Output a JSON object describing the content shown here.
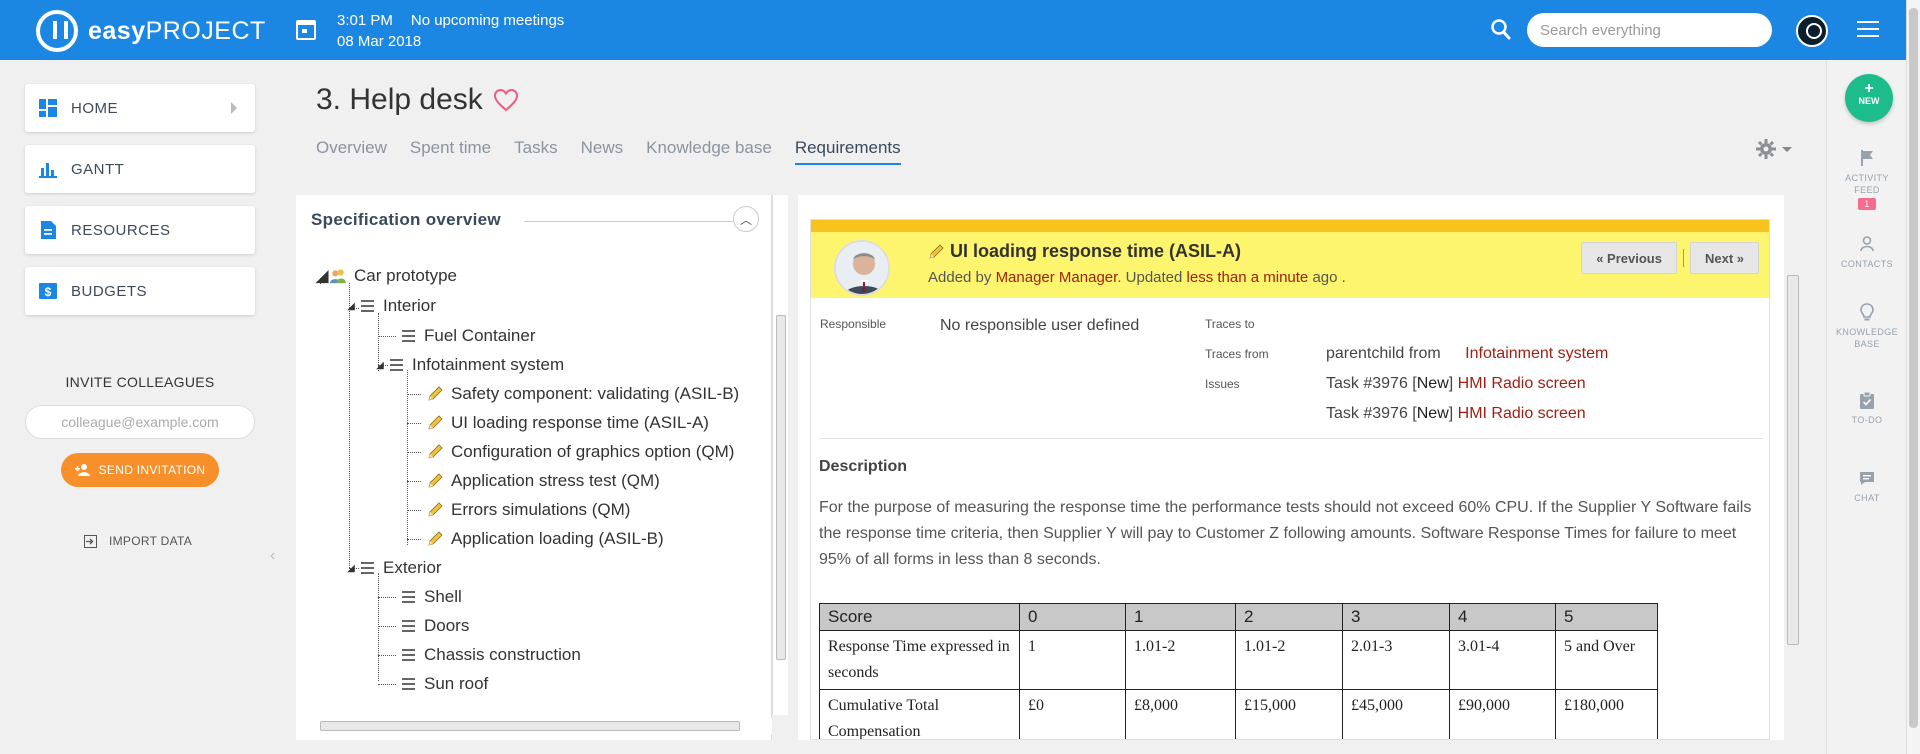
{
  "app": {
    "logo_bold": "easy",
    "logo_rest": "PROJECT"
  },
  "topbar": {
    "time": "3:01 PM",
    "meetings": "No upcoming meetings",
    "date": "08 Mar 2018",
    "search_placeholder": "Search everything"
  },
  "sidebar": {
    "items": [
      {
        "label": "HOME",
        "icon": "grid-icon"
      },
      {
        "label": "GANTT",
        "icon": "bar-chart-icon"
      },
      {
        "label": "RESOURCES",
        "icon": "document-icon"
      },
      {
        "label": "BUDGETS",
        "icon": "money-icon"
      }
    ],
    "invite_title": "INVITE COLLEAGUES",
    "invite_placeholder": "colleague@example.com",
    "send_label": "SEND INVITATION",
    "import_label": "IMPORT DATA"
  },
  "project": {
    "title": "3. Help desk",
    "tabs": [
      "Overview",
      "Spent time",
      "Tasks",
      "News",
      "Knowledge base",
      "Requirements"
    ],
    "active_tab": "Requirements"
  },
  "spec": {
    "title": "Specification overview",
    "tree": {
      "root": "Car prototype",
      "interior": "Interior",
      "fuel": "Fuel Container",
      "infotainment": "Infotainment system",
      "leaves": [
        "Safety component: validating (ASIL-B)",
        "UI loading response time (ASIL-A)",
        "Configuration of graphics option (QM)",
        "Application stress test (QM)",
        "Errors simulations (QM)",
        "Application loading (ASIL-B)"
      ],
      "exterior": "Exterior",
      "exterior_items": [
        "Shell",
        "Doors",
        "Chassis construction",
        "Sun roof"
      ]
    }
  },
  "detail": {
    "title": "UI loading response time (ASIL-A)",
    "added_by_prefix": "Added by",
    "author": "Manager Manager",
    "updated_prefix": ". Updated",
    "updated_when": "less than a minute",
    "updated_suffix": "ago .",
    "prev_label": "« Previous",
    "next_label": "Next »",
    "responsible_label": "Responsible",
    "responsible_value": "No responsible user defined",
    "traces_to_label": "Traces to",
    "traces_from_label": "Traces from",
    "issues_label": "Issues",
    "traces_from_prefix": "parentchild from",
    "traces_from_link": "Infotainment system",
    "issues": [
      {
        "prefix": "Task #3976 [",
        "status": "New",
        "mid": "]",
        "link": "HMI Radio screen"
      },
      {
        "prefix": "Task #3976 [",
        "status": "New",
        "mid": "]",
        "link": "HMI Radio screen"
      }
    ],
    "description_heading": "Description",
    "description": "For the purpose of measuring the response time the performance tests should not exceed 60% CPU.  If the Supplier Y Software fails the response time criteria, then Supplier Y will pay to Customer Z following amounts. Software Response Times for failure to meet 95% of all forms in less than 8 seconds.",
    "table": {
      "header": [
        "Score",
        "0",
        "1",
        "2",
        "3",
        "4",
        "5"
      ],
      "rows": [
        [
          "Response Time expressed in seconds",
          "1",
          "1.01-2",
          "1.01-2",
          "2.01-3",
          "3.01-4",
          "5 and Over"
        ],
        [
          "Cumulative Total Compensation",
          "£0",
          "£8,000",
          "£15,000",
          "£45,000",
          "£90,000",
          "£180,000"
        ]
      ]
    }
  },
  "rail": {
    "new_label": "NEW",
    "items": [
      {
        "label": "ACTIVITY FEED",
        "icon": "flag-icon",
        "badge": "1"
      },
      {
        "label": "CONTACTS",
        "icon": "person-icon"
      },
      {
        "label": "KNOWLEDGE BASE",
        "icon": "lightbulb-icon"
      },
      {
        "label": "TO-DO",
        "icon": "clipboard-icon"
      },
      {
        "label": "CHAT",
        "icon": "chat-icon"
      }
    ]
  },
  "colors": {
    "topbar": "#1c87e3",
    "accent_orange": "#f7902b",
    "link_red": "#a11f12",
    "header_yellow": "#fef56e",
    "new_green": "#1dbd8b"
  }
}
